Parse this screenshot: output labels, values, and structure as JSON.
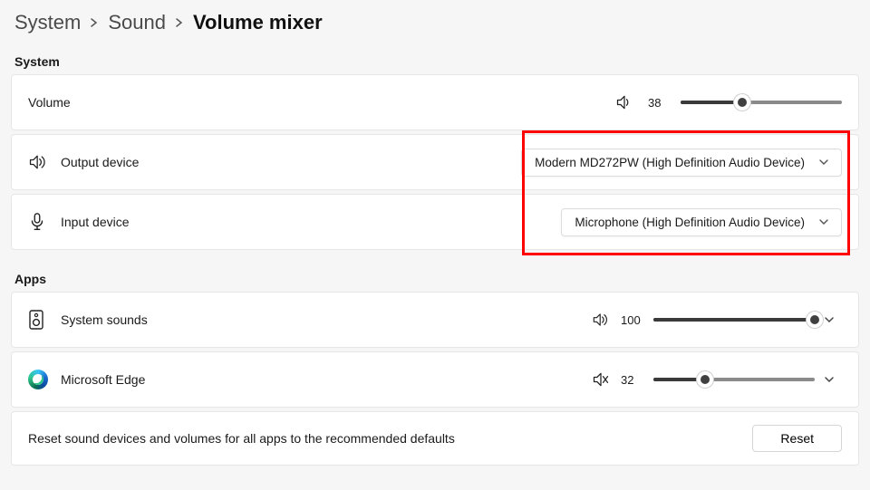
{
  "breadcrumb": {
    "level1": "System",
    "level2": "Sound",
    "current": "Volume mixer"
  },
  "sections": {
    "system_header": "System",
    "apps_header": "Apps"
  },
  "volume_row": {
    "label": "Volume",
    "value": 38
  },
  "output_device": {
    "label": "Output device",
    "selected": "Modern MD272PW (High Definition Audio Device)"
  },
  "input_device": {
    "label": "Input device",
    "selected": "Microphone (High Definition Audio Device)"
  },
  "apps": {
    "system_sounds": {
      "label": "System sounds",
      "value": 100,
      "muted": false
    },
    "edge": {
      "label": "Microsoft Edge",
      "value": 32,
      "muted": true
    }
  },
  "reset": {
    "description": "Reset sound devices and volumes for all apps to the recommended defaults",
    "button": "Reset"
  }
}
